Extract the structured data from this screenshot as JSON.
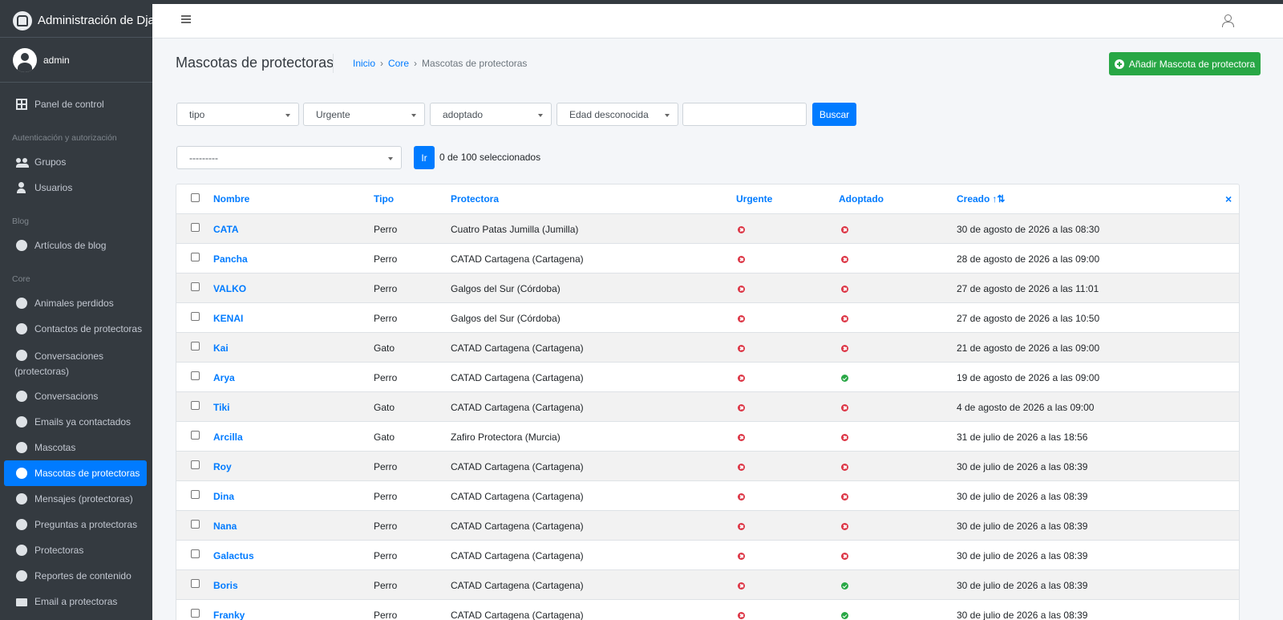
{
  "brand": {
    "title": "Administración de Djan"
  },
  "user_panel": {
    "name": "admin"
  },
  "sidebar": {
    "dashboard": "Panel de control",
    "sections": [
      {
        "header": "Autenticación y autorización",
        "items": [
          "Grupos",
          "Usuarios"
        ]
      },
      {
        "header": "Blog",
        "items": [
          "Artículos de blog"
        ]
      },
      {
        "header": "Core",
        "items": [
          "Animales perdidos",
          "Contactos de protectoras",
          "Conversaciones (protectoras)",
          "Conversacions",
          "Emails ya contactados",
          "Mascotas",
          "Mascotas de protectoras",
          "Mensajes (protectoras)",
          "Preguntas a protectoras",
          "Protectoras",
          "Reportes de contenido",
          "Email a protectoras"
        ]
      }
    ],
    "active_item": "Mascotas de protectoras"
  },
  "header": {
    "page_title": "Mascotas de protectoras",
    "breadcrumb": [
      "Inicio",
      "Core",
      "Mascotas de protectoras"
    ],
    "breadcrumb_sep": "›",
    "add_button": "Añadir Mascota de protectora"
  },
  "filters": {
    "tipo": "tipo",
    "urgente": "Urgente",
    "adoptado": "adoptado",
    "edad": "Edad desconocida",
    "search_value": "",
    "search_button": "Buscar"
  },
  "actions": {
    "action_select": "---------",
    "go_button": "Ir",
    "selection_count": "0 de 100 seleccionados"
  },
  "table": {
    "columns": [
      "Nombre",
      "Tipo",
      "Protectora",
      "Urgente",
      "Adoptado",
      "Creado"
    ],
    "sort_indicator": "↑⇅",
    "clear_sort": "×",
    "rows": [
      {
        "nombre": "CATA",
        "tipo": "Perro",
        "protectora": "Cuatro Patas Jumilla (Jumilla)",
        "urgente": false,
        "adoptado": false,
        "creado": "30 de agosto de 2026 a las 08:30"
      },
      {
        "nombre": "Pancha",
        "tipo": "Perro",
        "protectora": "CATAD Cartagena (Cartagena)",
        "urgente": false,
        "adoptado": false,
        "creado": "28 de agosto de 2026 a las 09:00"
      },
      {
        "nombre": "VALKO",
        "tipo": "Perro",
        "protectora": "Galgos del Sur (Córdoba)",
        "urgente": false,
        "adoptado": false,
        "creado": "27 de agosto de 2026 a las 11:01"
      },
      {
        "nombre": "KENAI",
        "tipo": "Perro",
        "protectora": "Galgos del Sur (Córdoba)",
        "urgente": false,
        "adoptado": false,
        "creado": "27 de agosto de 2026 a las 10:50"
      },
      {
        "nombre": "Kai",
        "tipo": "Gato",
        "protectora": "CATAD Cartagena (Cartagena)",
        "urgente": false,
        "adoptado": false,
        "creado": "21 de agosto de 2026 a las 09:00"
      },
      {
        "nombre": "Arya",
        "tipo": "Perro",
        "protectora": "CATAD Cartagena (Cartagena)",
        "urgente": false,
        "adoptado": true,
        "creado": "19 de agosto de 2026 a las 09:00"
      },
      {
        "nombre": "Tiki",
        "tipo": "Gato",
        "protectora": "CATAD Cartagena (Cartagena)",
        "urgente": false,
        "adoptado": false,
        "creado": "4 de agosto de 2026 a las 09:00"
      },
      {
        "nombre": "Arcilla",
        "tipo": "Gato",
        "protectora": "Zafiro Protectora (Murcia)",
        "urgente": false,
        "adoptado": false,
        "creado": "31 de julio de 2026 a las 18:56"
      },
      {
        "nombre": "Roy",
        "tipo": "Perro",
        "protectora": "CATAD Cartagena (Cartagena)",
        "urgente": false,
        "adoptado": false,
        "creado": "30 de julio de 2026 a las 08:39"
      },
      {
        "nombre": "Dina",
        "tipo": "Perro",
        "protectora": "CATAD Cartagena (Cartagena)",
        "urgente": false,
        "adoptado": false,
        "creado": "30 de julio de 2026 a las 08:39"
      },
      {
        "nombre": "Nana",
        "tipo": "Perro",
        "protectora": "CATAD Cartagena (Cartagena)",
        "urgente": false,
        "adoptado": false,
        "creado": "30 de julio de 2026 a las 08:39"
      },
      {
        "nombre": "Galactus",
        "tipo": "Perro",
        "protectora": "CATAD Cartagena (Cartagena)",
        "urgente": false,
        "adoptado": false,
        "creado": "30 de julio de 2026 a las 08:39"
      },
      {
        "nombre": "Boris",
        "tipo": "Perro",
        "protectora": "CATAD Cartagena (Cartagena)",
        "urgente": false,
        "adoptado": true,
        "creado": "30 de julio de 2026 a las 08:39"
      },
      {
        "nombre": "Franky",
        "tipo": "Perro",
        "protectora": "CATAD Cartagena (Cartagena)",
        "urgente": false,
        "adoptado": true,
        "creado": "30 de julio de 2026 a las 08:39"
      }
    ]
  },
  "colors": {
    "accent": "#007bff",
    "success": "#28a745",
    "danger": "#dc3545",
    "sidebar_bg": "#343a40"
  }
}
